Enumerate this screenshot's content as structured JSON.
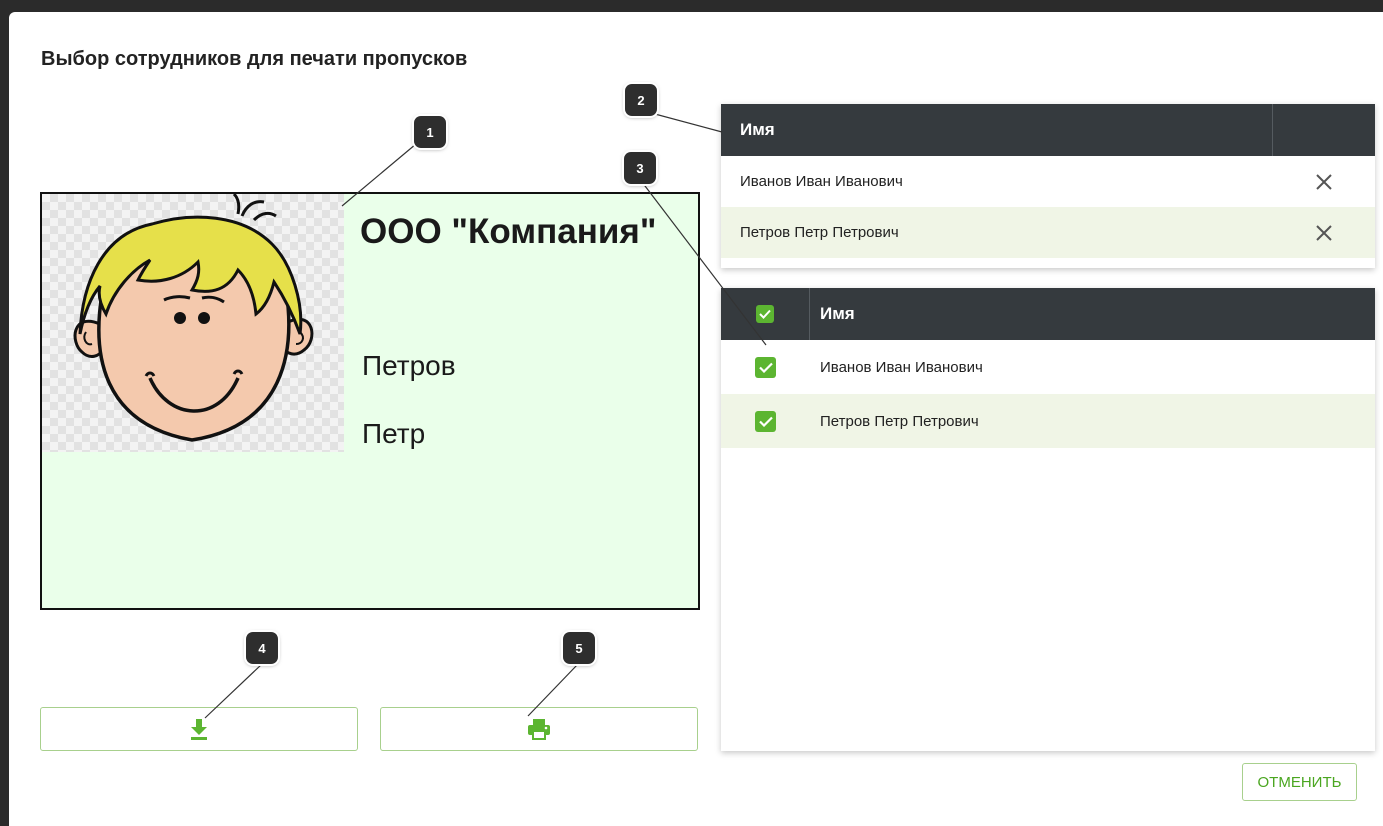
{
  "dialog": {
    "title": "Выбор сотрудников для печати пропусков",
    "cancel_label": "ОТМЕНИТЬ"
  },
  "badge": {
    "company": "ООО \"Компания\"",
    "last_name": "Петров",
    "first_name": "Петр",
    "background": "#eaffea"
  },
  "actions": {
    "download_icon": "download-icon",
    "print_icon": "printer-icon"
  },
  "selected_table": {
    "header": "Имя",
    "rows": [
      {
        "name": "Иванов Иван Иванович",
        "remove_icon": "close-icon"
      },
      {
        "name": "Петров Петр Петрович",
        "remove_icon": "close-icon"
      }
    ]
  },
  "employees_table": {
    "header": "Имя",
    "header_checked": true,
    "rows": [
      {
        "name": "Иванов Иван Иванович",
        "checked": true
      },
      {
        "name": "Петров Петр Петрович",
        "checked": true
      }
    ]
  },
  "markers": [
    "1",
    "2",
    "3",
    "4",
    "5"
  ],
  "colors": {
    "accent": "#5cb531",
    "header_bg": "#353a3e",
    "row_alt": "#f0f5e6"
  }
}
